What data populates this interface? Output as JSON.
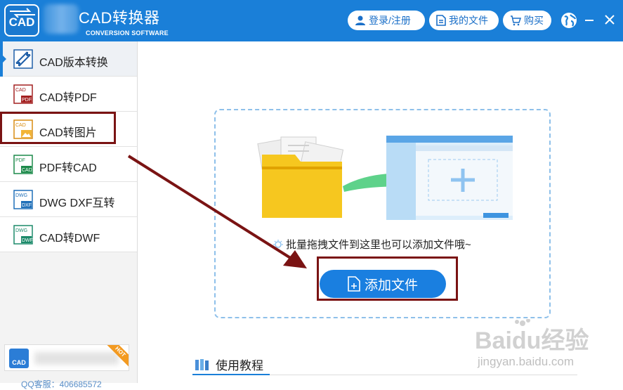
{
  "header": {
    "logo_text": "CAD",
    "title": "CAD转换器",
    "subtitle": "CONVERSION SOFTWARE",
    "login_label": "登录/注册",
    "myfiles_label": "我的文件",
    "buy_label": "购买",
    "icons": [
      "user-icon",
      "document-icon",
      "cart-icon",
      "globe-icon",
      "minimize-icon",
      "close-icon"
    ]
  },
  "sidebar": {
    "items": [
      {
        "label": "CAD版本转换",
        "icon": "cad-version-icon",
        "active": true
      },
      {
        "label": "CAD转PDF",
        "icon": "cad-to-pdf-icon"
      },
      {
        "label": "CAD转图片",
        "icon": "cad-to-image-icon",
        "highlighted": true
      },
      {
        "label": "PDF转CAD",
        "icon": "pdf-to-cad-icon"
      },
      {
        "label": "DWG DXF互转",
        "icon": "dwg-dxf-icon"
      },
      {
        "label": "CAD转DWF",
        "icon": "cad-to-dwf-icon"
      }
    ],
    "promo": {
      "icon_text": "CAD",
      "badge": "HOT"
    },
    "qq_text": "QQ客服：406685572"
  },
  "main": {
    "drop_hint": "批量拖拽文件到这里也可以添加文件哦~",
    "add_button": "添加文件",
    "tutorial_title": "使用教程"
  },
  "watermark": {
    "brand": "Baidu经验",
    "url": "jingyan.baidu.com"
  },
  "colors": {
    "primary": "#1a7fd8",
    "highlight": "#7a1313",
    "folder": "#f6c71f",
    "arrow_green": "#5ed28a"
  }
}
